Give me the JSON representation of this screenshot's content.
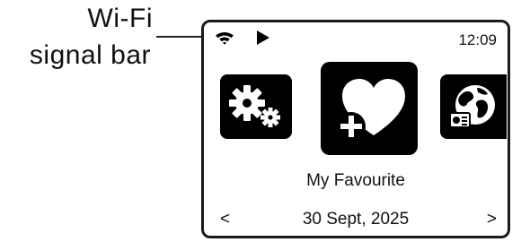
{
  "callout": {
    "line1": "Wi-Fi",
    "line2": "signal bar"
  },
  "status_bar": {
    "wifi_icon": "wifi-signal-icon",
    "play_icon": "play-icon",
    "time": "12:09"
  },
  "menu": {
    "items": [
      {
        "icon": "settings-gears-icon"
      },
      {
        "icon": "heart-plus-icon"
      },
      {
        "icon": "globe-radio-icon"
      }
    ],
    "selected_label": "My Favourite"
  },
  "footer": {
    "prev": "<",
    "date": "30 Sept, 2025",
    "next": ">"
  },
  "colors": {
    "screen_border": "#1a1a1a",
    "tile_fill": "#000000",
    "icon_fill": "#ffffff",
    "text": "#111111"
  }
}
